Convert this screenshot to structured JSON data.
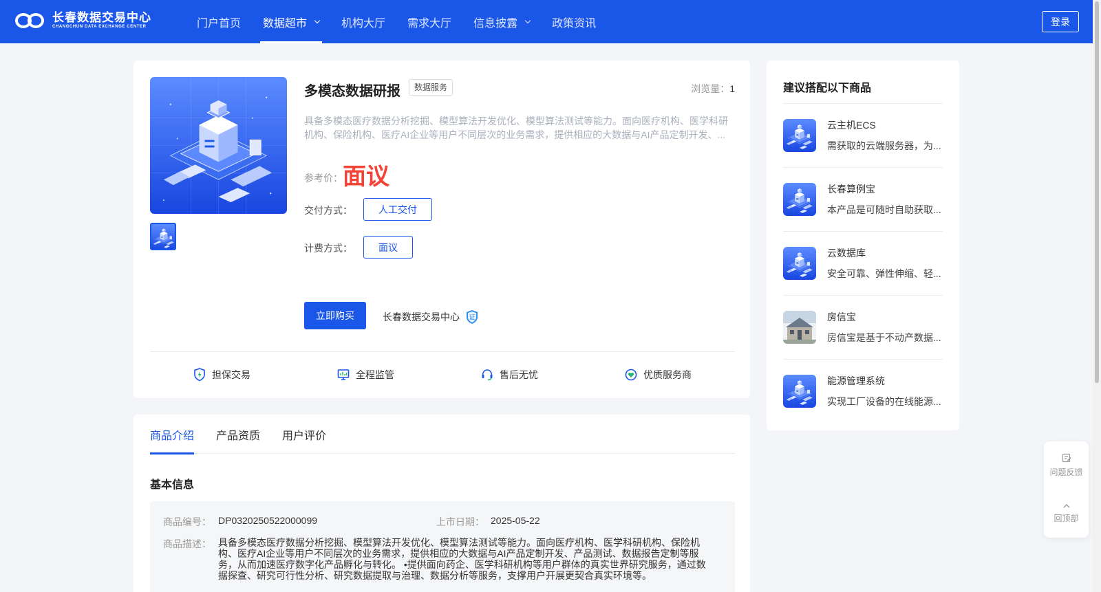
{
  "header": {
    "logo_cn": "长春数据交易中心",
    "logo_en": "CHANGCHUN DATA EXCHANGE CENTER",
    "nav": [
      {
        "label": "门户首页"
      },
      {
        "label": "数据超市"
      },
      {
        "label": "机构大厅"
      },
      {
        "label": "需求大厅"
      },
      {
        "label": "信息披露"
      },
      {
        "label": "政策资讯"
      }
    ],
    "login_label": "登录"
  },
  "product": {
    "title": "多模态数据研报",
    "tag": "数据服务",
    "views_label": "浏览量：",
    "views_value": "1",
    "description": "具备多模态医疗数据分析挖掘、模型算法开发优化、模型算法测试等能力。面向医疗机构、医学科研机构、保险机构、医疗AI企业等用户不同层次的业务需求，提供相应的大数据与AI产品定制开发、...",
    "price_label": "参考价：",
    "price_value": "面议",
    "delivery_label": "交付方式：",
    "delivery_value": "人工交付",
    "billing_label": "计费方式：",
    "billing_value": "面议",
    "buy_label": "立即购买",
    "seller_name": "长春数据交易中心",
    "verified_badge": "证",
    "guarantees": [
      "担保交易",
      "全程监管",
      "售后无忧",
      "优质服务商"
    ]
  },
  "recommend": {
    "title": "建议搭配以下商品",
    "items": [
      {
        "name": "云主机ECS",
        "desc": "需获取的云端服务器，为..."
      },
      {
        "name": "长春算例宝",
        "desc": "本产品是可随时自助获取..."
      },
      {
        "name": "云数据库",
        "desc": "安全可靠、弹性伸缩、轻..."
      },
      {
        "name": "房信宝",
        "desc": "房信宝是基于不动产数据..."
      },
      {
        "name": "能源管理系统",
        "desc": "实现工厂设备的在线能源..."
      }
    ]
  },
  "details": {
    "tabs": [
      "商品介绍",
      "产品资质",
      "用户评价"
    ],
    "section_title": "基本信息",
    "code_label": "商品编号：",
    "code_value": "DP0320250522000099",
    "date_label": "上市日期：",
    "date_value": "2025-05-22",
    "desc_label": "商品描述：",
    "desc_value": "具备多模态医疗数据分析挖掘、模型算法开发优化、模型算法测试等能力。面向医疗机构、医学科研机构、保险机构、医疗AI企业等用户不同层次的业务需求，提供相应的大数据与AI产品定制开发、产品测试、数据报告定制等服务，从而加速医疗数字化产品孵化与转化。 •提供面向药企、医学科研机构等用户群体的真实世界研究服务，通过数据探查、研究可行性分析、研究数据提取与治理、数据分析等服务，支撑用户开展更契合真实环境等。"
  },
  "tools": {
    "feedback_label": "问题反馈",
    "top_label": "回顶部"
  },
  "colors": {
    "brand": "#1a56e8",
    "price": "#f44336"
  }
}
